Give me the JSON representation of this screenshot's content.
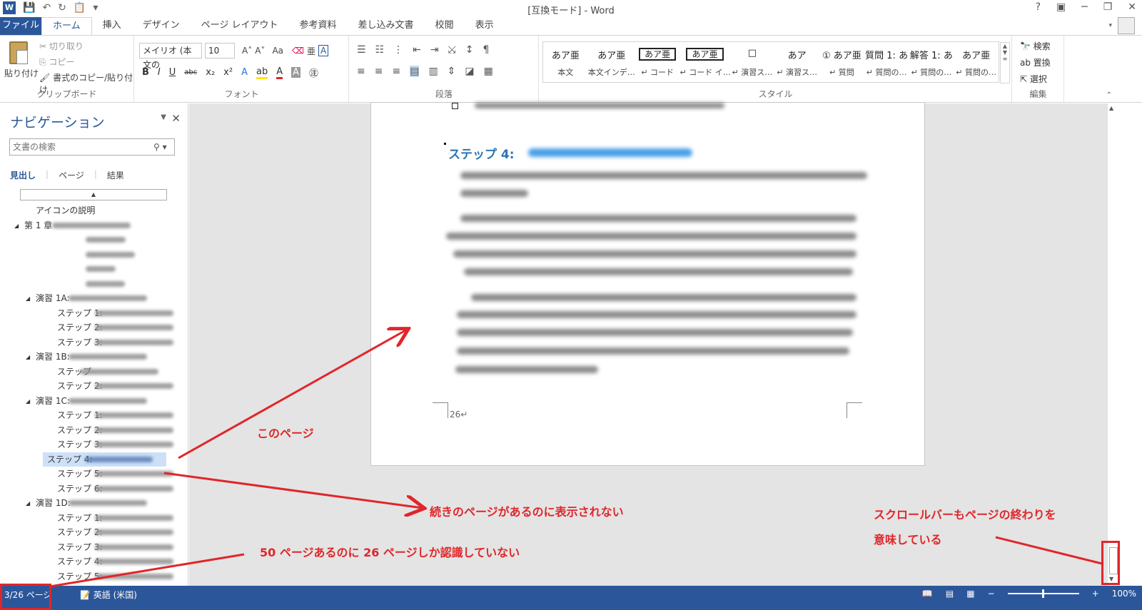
{
  "window": {
    "title": "[互換モード] - Word",
    "controls": [
      "?",
      "▣",
      "─",
      "❐",
      "✕"
    ]
  },
  "qat": {
    "app_icon": "W",
    "save": "💾",
    "undo": "↶",
    "redo": "↻",
    "paste": "📋",
    "more": "▾"
  },
  "tabs": [
    "ファイル",
    "ホーム",
    "挿入",
    "デザイン",
    "ページ レイアウト",
    "参考資料",
    "差し込み文書",
    "校閲",
    "表示"
  ],
  "ribbon": {
    "clipboard": {
      "paste": "貼り付け",
      "cut": "切り取り",
      "copy": "コピー",
      "format_painter": "書式のコピー/貼り付け",
      "label": "クリップボード"
    },
    "font": {
      "name": "メイリオ (本文の",
      "size": "10",
      "grow": "A˄",
      "shrink": "A˅",
      "case": "Aa",
      "label": "フォント",
      "row2": [
        "B",
        "I",
        "U",
        "abc",
        "x₂",
        "x²",
        "A",
        "ab",
        "A",
        "A",
        "㊟"
      ]
    },
    "paragraph": {
      "label": "段落",
      "row1": [
        "☰",
        "☷",
        "⋮",
        "⇤",
        "⇥",
        "⤩",
        "↕",
        "¶"
      ],
      "row2": [
        "≡",
        "≡",
        "≡",
        "▤",
        "▥",
        "⇕",
        "◪",
        "▦"
      ]
    },
    "styles": {
      "label": "スタイル",
      "items": [
        {
          "preview": "あア亜",
          "name": "本文"
        },
        {
          "preview": "あア亜",
          "name": "本文インデ…"
        },
        {
          "preview": "あア亜",
          "name": "↵ コード",
          "boxed": true
        },
        {
          "preview": "あア亜",
          "name": "↵ コード イ…",
          "boxed": true
        },
        {
          "preview": "□",
          "name": "↵ 演習ス…"
        },
        {
          "preview": "あア",
          "name": "↵ 演習ス…"
        },
        {
          "preview": "① あア亜",
          "name": "↵ 質問"
        },
        {
          "preview": "質問 1: あ",
          "name": "↵ 質問の…"
        },
        {
          "preview": "解答 1: あ",
          "name": "↵ 質問の…"
        },
        {
          "preview": "あア亜",
          "name": "↵ 質問の…"
        }
      ]
    },
    "editing": {
      "find": "検索",
      "replace": "置換",
      "select": "選択",
      "label": "編集"
    }
  },
  "nav": {
    "title": "ナビゲーション",
    "search_placeholder": "文書の検索",
    "tabs": [
      "見出し",
      "ページ",
      "結果"
    ],
    "tree": [
      {
        "label": "アイコンの説明",
        "level": 1,
        "tri": false
      },
      {
        "label": "第 1 章",
        "level": 0,
        "tri": true
      },
      {
        "label": "",
        "level": 2,
        "tri": false
      },
      {
        "label": "",
        "level": 2,
        "tri": false
      },
      {
        "label": "",
        "level": 2,
        "tri": false
      },
      {
        "label": "",
        "level": 2,
        "tri": false
      },
      {
        "label": "演習 1A:",
        "level": 1,
        "tri": true
      },
      {
        "label": "ステップ 1:",
        "level": 2,
        "tri": false
      },
      {
        "label": "ステップ 2:",
        "level": 2,
        "tri": false
      },
      {
        "label": "ステップ 3:",
        "level": 2,
        "tri": false
      },
      {
        "label": "演習 1B:",
        "level": 1,
        "tri": true
      },
      {
        "label": "ステップ",
        "level": 2,
        "tri": false
      },
      {
        "label": "ステップ 2:",
        "level": 2,
        "tri": false
      },
      {
        "label": "演習 1C:",
        "level": 1,
        "tri": true
      },
      {
        "label": "ステップ 1:",
        "level": 2,
        "tri": false
      },
      {
        "label": "ステップ 2:",
        "level": 2,
        "tri": false
      },
      {
        "label": "ステップ 3:",
        "level": 2,
        "tri": false
      },
      {
        "label": "ステップ 4:",
        "level": 2,
        "tri": false,
        "selected": true
      },
      {
        "label": "ステップ 5:",
        "level": 2,
        "tri": false
      },
      {
        "label": "ステップ 6:",
        "level": 2,
        "tri": false
      },
      {
        "label": "演習 1D:",
        "level": 1,
        "tri": true
      },
      {
        "label": "ステップ 1:",
        "level": 2,
        "tri": false
      },
      {
        "label": "ステップ 2:",
        "level": 2,
        "tri": false
      },
      {
        "label": "ステップ 3:",
        "level": 2,
        "tri": false
      },
      {
        "label": "ステップ 4:",
        "level": 2,
        "tri": false
      },
      {
        "label": "ステップ 5:",
        "level": 2,
        "tri": false
      }
    ]
  },
  "document": {
    "heading": "ステップ 4:",
    "page_number": "26↵"
  },
  "status": {
    "page": "3/26 ページ",
    "language": "英語 (米国)",
    "zoom": "100%"
  },
  "annotations": {
    "this_page": "このページ",
    "not_shown": "続きのページがあるのに表示されない",
    "scrollbar_line1": "スクロールバーもページの終わりを",
    "scrollbar_line2": "意味している",
    "page_count": "50 ページあるのに 26 ページしか認識していない"
  },
  "colors": {
    "accent": "#2b579a",
    "annotation": "#e0262a",
    "heading": "#2e74b5"
  }
}
